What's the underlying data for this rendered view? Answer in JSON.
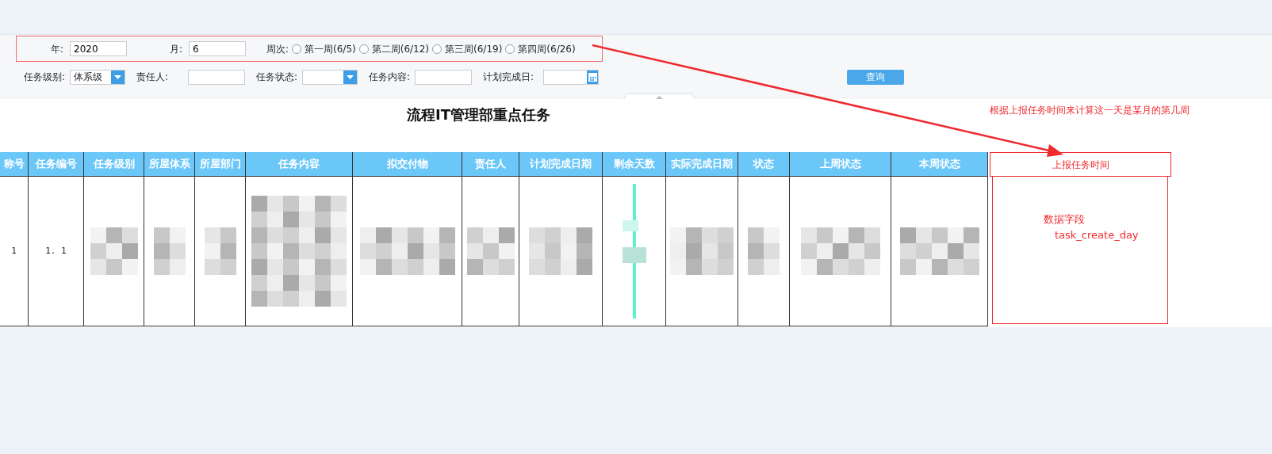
{
  "filters": {
    "year": {
      "label": "年:",
      "value": "2020"
    },
    "month": {
      "label": "月:",
      "value": "6"
    },
    "week": {
      "label": "周次:",
      "options": [
        {
          "label": "第一周(6/5)",
          "selected": false
        },
        {
          "label": "第二周(6/12)",
          "selected": false
        },
        {
          "label": "第三周(6/19)",
          "selected": false
        },
        {
          "label": "第四周(6/26)",
          "selected": false
        }
      ]
    },
    "fields": [
      {
        "kind": "select",
        "label": "任务级别:",
        "value": "体系级"
      },
      {
        "kind": "text",
        "label": "责任人:"
      },
      {
        "kind": "select",
        "label": "任务状态:"
      },
      {
        "kind": "text",
        "label": "任务内容:"
      },
      {
        "kind": "date",
        "label": "计划完成日:"
      }
    ],
    "query_button": "查询"
  },
  "title": "流程IT管理部重点任务",
  "note": "根据上报任务时间来计算这一天是某月的第几周",
  "table": {
    "columns": [
      "称号",
      "任务编号",
      "任务级别",
      "所屋体系",
      "所屋部门",
      "任务内容",
      "拟交付物",
      "责任人",
      "计划完成日期",
      "剩余天数",
      "实际完成日期",
      "状态",
      "上周状态",
      "本周状态"
    ],
    "rows": [
      {
        "cells": [
          {
            "kind": "text",
            "text": "1"
          },
          {
            "kind": "text",
            "text": "1. 1"
          },
          {
            "kind": "blurred"
          },
          {
            "kind": "blurred"
          },
          {
            "kind": "blurred"
          },
          {
            "kind": "blurred"
          },
          {
            "kind": "blurred"
          },
          {
            "kind": "blurred"
          },
          {
            "kind": "blurred"
          },
          {
            "kind": "bar"
          },
          {
            "kind": "blurred"
          },
          {
            "kind": "blurred"
          },
          {
            "kind": "blurred"
          },
          {
            "kind": "blurred"
          }
        ]
      }
    ]
  },
  "added_column": {
    "header": "上报任务时间",
    "lines": [
      "数据字段",
      "task_create_day"
    ]
  }
}
